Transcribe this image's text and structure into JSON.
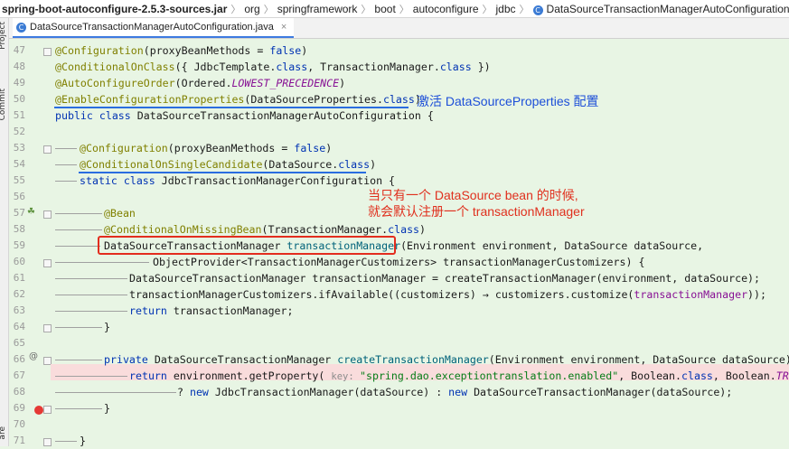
{
  "breadcrumb": {
    "items": [
      "spring-boot-autoconfigure-2.5.3-sources.jar",
      "org",
      "springframework",
      "boot",
      "autoconfigure",
      "jdbc"
    ],
    "current": "DataSourceTransactionManagerAutoConfiguration"
  },
  "sidebar": {
    "project_label": "Project",
    "commit_label": "Commit",
    "bottom_label": "are"
  },
  "tab": {
    "label": "DataSourceTransactionManagerAutoConfiguration.java",
    "close": "×"
  },
  "line_numbers": [
    "47",
    "48",
    "49",
    "50",
    "51",
    "52",
    "53",
    "54",
    "55",
    "56",
    "57",
    "58",
    "59",
    "60",
    "61",
    "62",
    "63",
    "64",
    "65",
    "66",
    "67",
    "68",
    "69",
    "70",
    "71"
  ],
  "code": {
    "l47": {
      "a": "@Configuration",
      "b": "(proxyBeanMethods = ",
      "c": "false",
      "d": ")"
    },
    "l48": {
      "a": "@ConditionalOnClass",
      "b": "({ JdbcTemplate.",
      "c": "class",
      "d": ", TransactionManager.",
      "e": "class",
      "f": " })"
    },
    "l49": {
      "a": "@AutoConfigureOrder",
      "b": "(Ordered.",
      "c": "LOWEST_PRECEDENCE",
      "d": ")"
    },
    "l50": {
      "a": "@EnableConfigurationProperties",
      "b": "(DataSourceProperties.",
      "c": "class",
      "d": ")"
    },
    "l51": {
      "a": "public class ",
      "b": "DataSourceTransactionManagerAutoConfiguration {"
    },
    "l53": {
      "a": "@Configuration",
      "b": "(proxyBeanMethods = ",
      "c": "false",
      "d": ")"
    },
    "l54": {
      "a": "@ConditionalOnSingleCandidate",
      "b": "(DataSource.",
      "c": "class",
      "d": ")"
    },
    "l55": {
      "a": "static class ",
      "b": "JdbcTransactionManagerConfiguration {"
    },
    "l57": {
      "a": "@Bean"
    },
    "l58": {
      "a": "@ConditionalOnMissingBean",
      "b": "(TransactionManager.",
      "c": "class",
      "d": ")"
    },
    "l59": {
      "a": "DataSourceTransactionManager ",
      "b": "transactionManager",
      "c": "(Environment environment, DataSource dataSource,"
    },
    "l60": {
      "a": "ObjectProvider<TransactionManagerCustomizers> transactionManagerCustomizers) {"
    },
    "l61": {
      "a": "DataSourceTransactionManager transactionManager = createTransactionManager(environment, dataSource);"
    },
    "l62": {
      "a": "transactionManagerCustomizers.ifAvailable((customizers) → customizers.customize(",
      "b": "transactionManager",
      "c": "));"
    },
    "l63": {
      "a": "return ",
      "b": "transactionManager;"
    },
    "l64": {
      "a": "}"
    },
    "l66": {
      "a": "private ",
      "b": "DataSourceTransactionManager ",
      "c": "createTransactionManager",
      "d": "(Environment environment, DataSource dataSource) {"
    },
    "l67": {
      "a": "return ",
      "b": "environment.getProperty( ",
      "c": "key: ",
      "d": "\"spring.dao.exceptiontranslation.enabled\"",
      "e": ", Boolean.",
      "f": "class",
      "g": ", Boolean.",
      "h": "TRUE",
      "i": ")"
    },
    "l68": {
      "a": "? ",
      "b": "new ",
      "c": "JdbcTransactionManager(dataSource) : ",
      "d": "new ",
      "e": "DataSourceTransactionManager(dataSource);"
    },
    "l69": {
      "a": "}"
    },
    "l71": {
      "a": "}"
    }
  },
  "annotations": {
    "blue_note": "激活 DataSourceProperties 配置",
    "red_note_line1": "当只有一个 DataSource bean 的时候,",
    "red_note_line2": "就会默认注册一个 transactionManager"
  },
  "colors": {
    "background": "#e8f5e4",
    "annotation": "#808000",
    "keyword": "#0033b3",
    "red": "#e32d1e",
    "blue": "#2a6de0"
  }
}
